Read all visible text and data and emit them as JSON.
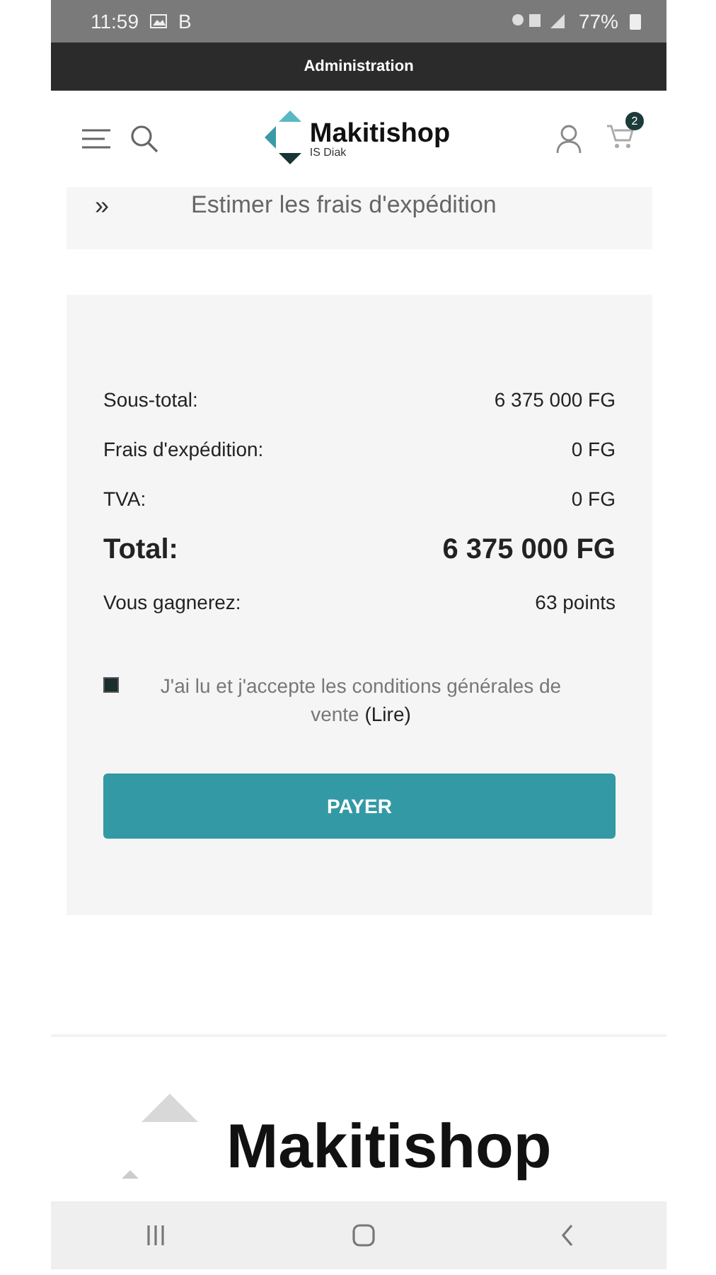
{
  "status_bar": {
    "time": "11:59",
    "carrier": "B",
    "battery": "77%"
  },
  "admin_bar": {
    "title": "Administration"
  },
  "header": {
    "logo_name": "Makitishop",
    "logo_subtitle": "IS Diak",
    "cart_count": "2"
  },
  "shipping": {
    "toggle": "»",
    "label": "Estimer les frais d'expédition"
  },
  "summary": {
    "rows": [
      {
        "kind": "normal",
        "label": "Sous-total:",
        "value": "6 375 000 FG"
      },
      {
        "kind": "normal",
        "label": "Frais d'expédition:",
        "value": "0 FG"
      },
      {
        "kind": "normal",
        "label": "TVA:",
        "value": "0 FG"
      },
      {
        "kind": "total",
        "label": "Total:",
        "value": "6 375 000 FG"
      },
      {
        "kind": "normal",
        "label": "Vous gagnerez:",
        "value": "63 points"
      }
    ],
    "terms": {
      "checked": true,
      "text": "J'ai lu et j'accepte les conditions générales de vente",
      "link": "(Lire)"
    },
    "pay_button": "PAYER"
  },
  "footer": {
    "logo_name": "Makitishop"
  }
}
